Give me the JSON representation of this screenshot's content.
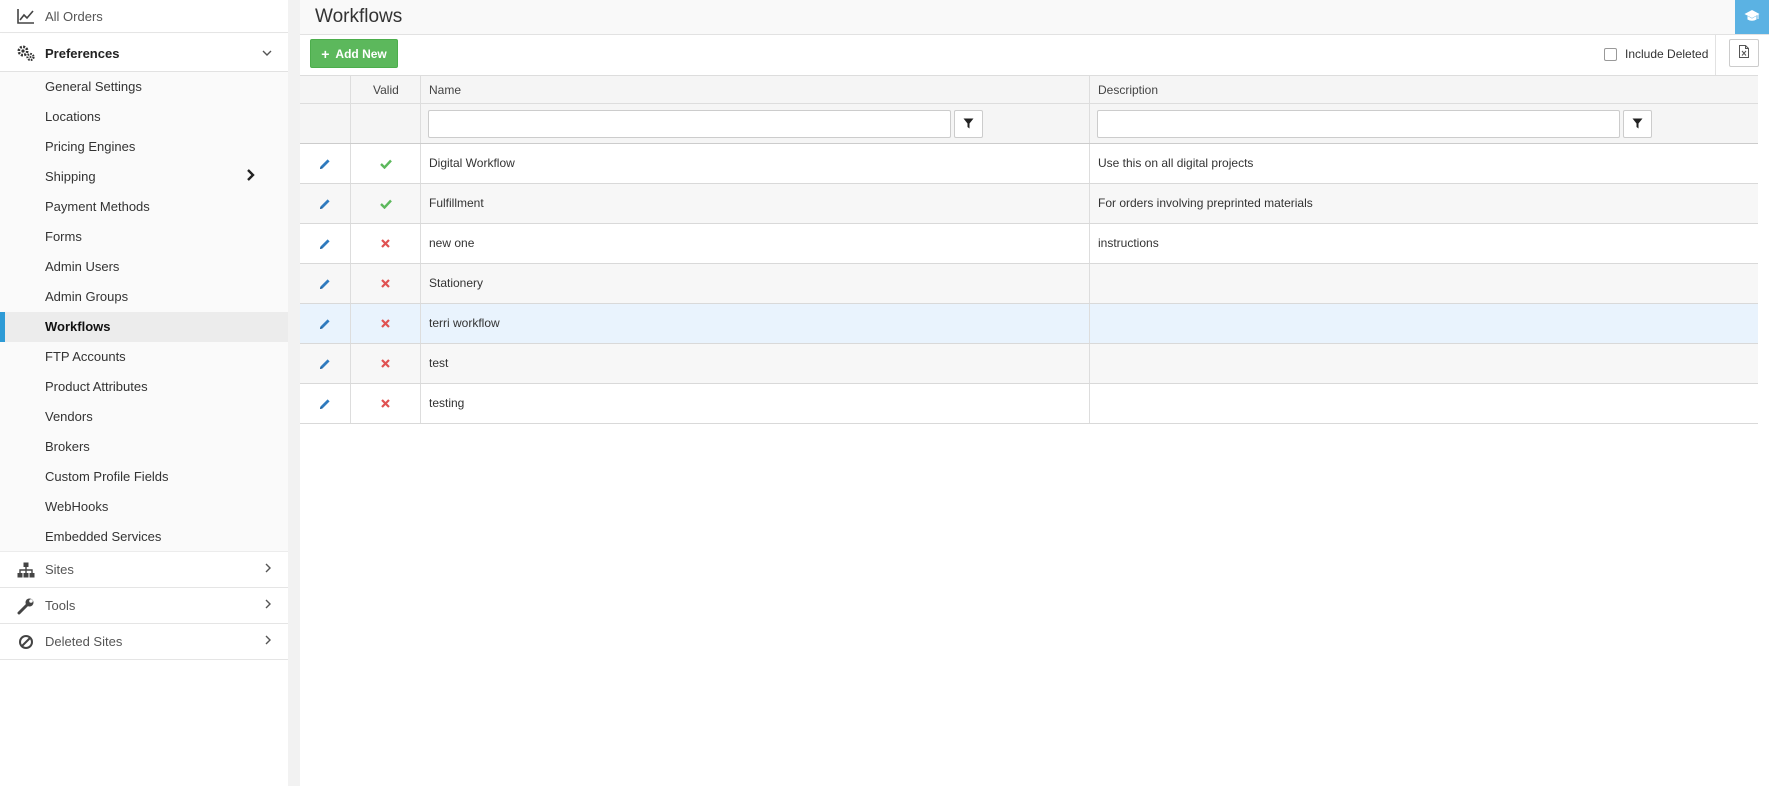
{
  "sidebar": {
    "all_orders": "All Orders",
    "preferences": "Preferences",
    "submenu": [
      "General Settings",
      "Locations",
      "Pricing Engines",
      "Shipping",
      "Payment Methods",
      "Forms",
      "Admin Users",
      "Admin Groups",
      "Workflows",
      "FTP Accounts",
      "Product Attributes",
      "Vendors",
      "Brokers",
      "Custom Profile Fields",
      "WebHooks",
      "Embedded Services"
    ],
    "active_item": "Workflows",
    "sites": "Sites",
    "tools": "Tools",
    "deleted_sites": "Deleted Sites"
  },
  "header": {
    "title": "Workflows",
    "help_icon": "graduation-cap-icon"
  },
  "toolbar": {
    "add_label": "Add New",
    "include_deleted_label": "Include Deleted",
    "include_deleted_checked": false
  },
  "grid": {
    "columns": [
      "",
      "Valid",
      "Name",
      "Description"
    ],
    "filters": {
      "name": "",
      "description": ""
    },
    "rows": [
      {
        "valid": true,
        "name": "Digital Workflow",
        "description": "Use this on all digital projects"
      },
      {
        "valid": true,
        "name": "Fulfillment",
        "description": "For orders involving preprinted materials"
      },
      {
        "valid": false,
        "name": "new one",
        "description": "instructions"
      },
      {
        "valid": false,
        "name": "Stationery",
        "description": ""
      },
      {
        "valid": false,
        "name": "terri workflow",
        "description": ""
      },
      {
        "valid": false,
        "name": "test",
        "description": ""
      },
      {
        "valid": false,
        "name": "testing",
        "description": ""
      }
    ]
  },
  "colors": {
    "accent": "#2e9bd6",
    "add_button": "#5cb85c",
    "valid": "#5cb85c",
    "invalid": "#e05252",
    "help_button": "#5bb2e3"
  }
}
